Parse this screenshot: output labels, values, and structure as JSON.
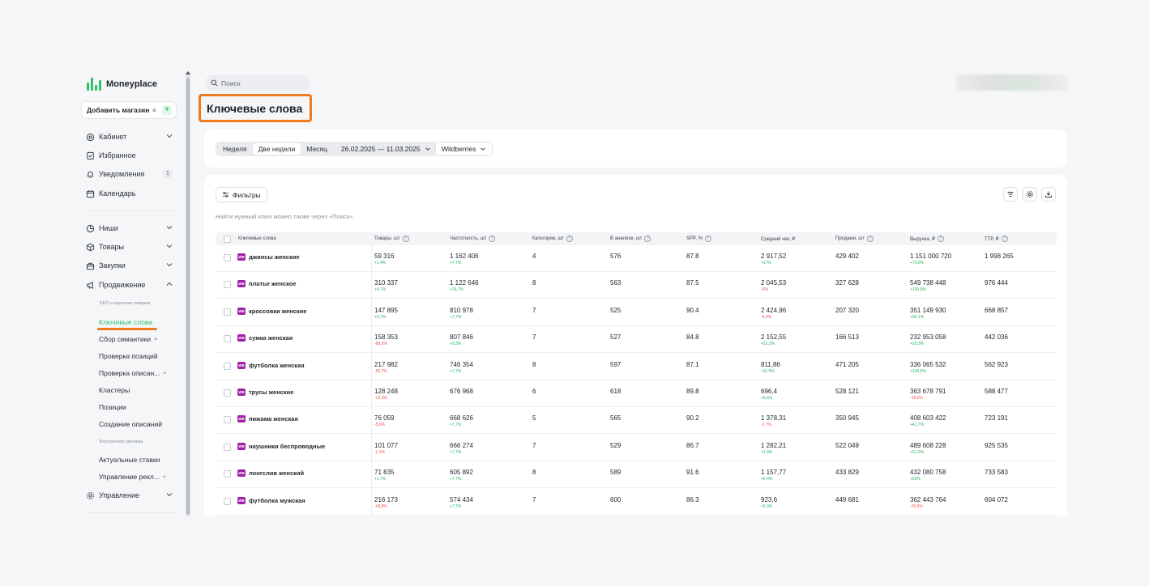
{
  "app": {
    "name": "Moneyplace",
    "brand_color": "#2cc36b",
    "highlight_color": "#f07a1e"
  },
  "sidebar": {
    "add_store_label": "Добавить магазин",
    "main_items": [
      {
        "label": "Кабинет",
        "icon": "briefcase-icon"
      },
      {
        "label": "Избранное",
        "icon": "bookmark-icon"
      },
      {
        "label": "Уведомления",
        "icon": "bell-icon",
        "badge": "1"
      },
      {
        "label": "Календарь",
        "icon": "calendar-icon"
      }
    ],
    "section_items": [
      {
        "label": "Ниши",
        "icon": "pie-chart-icon"
      },
      {
        "label": "Товары",
        "icon": "box-icon"
      },
      {
        "label": "Закупки",
        "icon": "basket-icon"
      },
      {
        "label": "Продвижение",
        "icon": "megaphone-icon"
      }
    ],
    "seo_header": "SEO и карточки товаров",
    "seo_items": [
      {
        "label": "Ключевые слова",
        "active": true
      },
      {
        "label": "Сбор семантики",
        "locked": true
      },
      {
        "label": "Проверка позиций"
      },
      {
        "label": "Проверка описан...",
        "locked": true
      },
      {
        "label": "Кластеры"
      },
      {
        "label": "Позиции"
      },
      {
        "label": "Создание описаний"
      }
    ],
    "ads_header": "Внутренняя реклама",
    "ads_items": [
      {
        "label": "Актуальные ставки"
      },
      {
        "label": "Управление рекл...",
        "locked": true
      }
    ],
    "manage_label": "Управление"
  },
  "header": {
    "search_placeholder": "Поиск",
    "page_title": "Ключевые слова"
  },
  "period": {
    "options": [
      "Неделя",
      "Две недели",
      "Месяц"
    ],
    "selected": "Две недели",
    "date_range": "26.02.2025 — 11.03.2025",
    "marketplace": "Wildberries"
  },
  "table": {
    "filters_label": "Фильтры",
    "hint": "Найти нужный ключ можно также через «Поиск».",
    "columns": [
      {
        "label": "Ключевые слова",
        "help": false
      },
      {
        "label": "Товары, шт",
        "help": true
      },
      {
        "label": "Частотность, шт",
        "help": true
      },
      {
        "label": "Категории, шт",
        "help": true
      },
      {
        "label": "В анализе, шт",
        "help": true
      },
      {
        "label": "SPP, %",
        "help": true
      },
      {
        "label": "Средний чек, ₽",
        "help": false
      },
      {
        "label": "Продажи, шт",
        "help": true
      },
      {
        "label": "Выручка, ₽",
        "help": true
      },
      {
        "label": "TTP, ₽",
        "help": true
      }
    ],
    "rows": [
      {
        "kw": "джинсы женские",
        "goods": "59 316",
        "goods_ch": "+1,4%",
        "goods_up": true,
        "freq": "1 162 406",
        "freq_ch": "+7,7%",
        "freq_up": true,
        "cat": "4",
        "an": "576",
        "spp": "87.8",
        "avg": "2 917,52",
        "avg_ch": "+17%",
        "avg_up": true,
        "sales": "429 402",
        "rev": "1 151 000 720",
        "rev_ch": "+73,6%",
        "rev_up": true,
        "ttp": "1 998 265"
      },
      {
        "kw": "платье женское",
        "goods": "310 337",
        "goods_ch": "+4,7%",
        "goods_up": true,
        "freq": "1 122 646",
        "freq_ch": "+16,7%",
        "freq_up": true,
        "cat": "8",
        "an": "563",
        "spp": "87.5",
        "avg": "2 045,53",
        "avg_ch": "-3%",
        "avg_up": false,
        "sales": "327 628",
        "rev": "549 738 448",
        "rev_ch": "+100,9%",
        "rev_up": true,
        "ttp": "976 444"
      },
      {
        "kw": "кроссовки женские",
        "goods": "147 895",
        "goods_ch": "+0,1%",
        "goods_up": true,
        "freq": "810 978",
        "freq_ch": "+7,7%",
        "freq_up": true,
        "cat": "7",
        "an": "525",
        "spp": "90.4",
        "avg": "2 424,96",
        "avg_ch": "-0,4%",
        "avg_up": false,
        "sales": "207 320",
        "rev": "351 149 930",
        "rev_ch": "+90,1%",
        "rev_up": true,
        "ttp": "668 857"
      },
      {
        "kw": "сумка женская",
        "goods": "158 353",
        "goods_ch": "-86,3%",
        "goods_up": false,
        "freq": "807 846",
        "freq_ch": "+9,3%",
        "freq_up": true,
        "cat": "7",
        "an": "527",
        "spp": "84.8",
        "avg": "2 152,55",
        "avg_ch": "+12,2%",
        "avg_up": true,
        "sales": "166 513",
        "rev": "232 953 058",
        "rev_ch": "+20,3%",
        "rev_up": true,
        "ttp": "442 036"
      },
      {
        "kw": "футболка женская",
        "goods": "217 982",
        "goods_ch": "-50,7%",
        "goods_up": false,
        "freq": "746 354",
        "freq_ch": "+7,7%",
        "freq_up": true,
        "cat": "8",
        "an": "597",
        "spp": "87.1",
        "avg": "811,86",
        "avg_ch": "+11,5%",
        "avg_up": true,
        "sales": "471 205",
        "rev": "336 065 532",
        "rev_ch": "+106,6%",
        "rev_up": true,
        "ttp": "562 923"
      },
      {
        "kw": "трусы женские",
        "goods": "128 248",
        "goods_ch": "-12,3%",
        "goods_up": false,
        "freq": "676 968",
        "freq_ch": "",
        "freq_up": true,
        "cat": "6",
        "an": "618",
        "spp": "89.8",
        "avg": "696,4",
        "avg_ch": "+5,6%",
        "avg_up": true,
        "sales": "528 121",
        "rev": "363 678 791",
        "rev_ch": "-18,6%",
        "rev_up": false,
        "ttp": "588 477"
      },
      {
        "kw": "пижама женская",
        "goods": "76 059",
        "goods_ch": "-5,6%",
        "goods_up": false,
        "freq": "668 626",
        "freq_ch": "+7,7%",
        "freq_up": true,
        "cat": "5",
        "an": "565",
        "spp": "90.2",
        "avg": "1 378,31",
        "avg_ch": "-1,7%",
        "avg_up": false,
        "sales": "350 945",
        "rev": "408 603 422",
        "rev_ch": "+41,7%",
        "rev_up": true,
        "ttp": "723 191"
      },
      {
        "kw": "наушники беспроводные",
        "goods": "101 077",
        "goods_ch": "-1,1%",
        "goods_up": false,
        "freq": "666 274",
        "freq_ch": "+7,7%",
        "freq_up": true,
        "cat": "7",
        "an": "529",
        "spp": "86.7",
        "avg": "1 282,21",
        "avg_ch": "+1,9%",
        "avg_up": true,
        "sales": "522 049",
        "rev": "489 608 228",
        "rev_ch": "+61,2%",
        "rev_up": true,
        "ttp": "925 535"
      },
      {
        "kw": "лонгслив женский",
        "goods": "71 835",
        "goods_ch": "+1,7%",
        "goods_up": true,
        "freq": "605 892",
        "freq_ch": "+7,7%",
        "freq_up": true,
        "cat": "8",
        "an": "589",
        "spp": "91.6",
        "avg": "1 157,77",
        "avg_ch": "+5,4%",
        "avg_up": true,
        "sales": "433 829",
        "rev": "432 080 758",
        "rev_ch": "+53%",
        "rev_up": true,
        "ttp": "733 583"
      },
      {
        "kw": "футболка мужская",
        "goods": "216 173",
        "goods_ch": "-43,8%",
        "goods_up": false,
        "freq": "574 434",
        "freq_ch": "+7,7%",
        "freq_up": true,
        "cat": "7",
        "an": "600",
        "spp": "86.3",
        "avg": "923,6",
        "avg_ch": "+5,3%",
        "avg_up": true,
        "sales": "449 681",
        "rev": "362 443 764",
        "rev_ch": "-26,6%",
        "rev_up": false,
        "ttp": "604 072"
      }
    ]
  }
}
